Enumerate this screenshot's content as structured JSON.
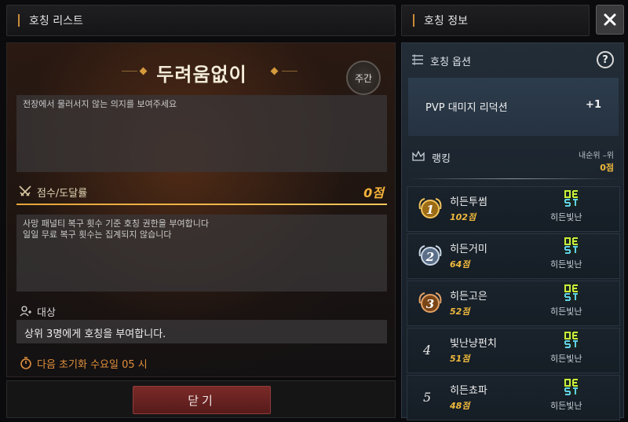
{
  "left_panel": {
    "header_title": "호칭 리스트",
    "title_name": "두려움없이",
    "period_badge": "주간",
    "description": "전장에서 물러서지 않는 의지를 보여주세요",
    "score_label": "점수/도달률",
    "score_value": "0점",
    "condition_line1": "사망 패널티 복구 횟수 기준 호칭 권한을 부여합니다",
    "condition_line2": "일일 무료 복구 횟수는 집계되지 않습니다",
    "target_label": "대상",
    "target_text": "상위 3명에게 호칭을 부여합니다.",
    "reset_text": "다음 초기화 수요일 05 시",
    "close_button": "닫기"
  },
  "right_panel": {
    "header_title": "호칭 정보",
    "options_label": "호칭 옵션",
    "option_name": "PVP 대미지 리덕션",
    "option_value": "+1",
    "ranking_label": "랭킹",
    "my_rank": "내순위 –위",
    "my_score": "0점",
    "rows": [
      {
        "rank": "1",
        "name": "히든투썸",
        "score": "102점",
        "title": "히든빛난",
        "medal": "gold"
      },
      {
        "rank": "2",
        "name": "히든거미",
        "score": "64점",
        "title": "히든빛난",
        "medal": "silver"
      },
      {
        "rank": "3",
        "name": "히든고은",
        "score": "52점",
        "title": "히든빛난",
        "medal": "bronze"
      },
      {
        "rank": "4",
        "name": "빛난냥펀치",
        "score": "51점",
        "title": "히든빛난",
        "medal": ""
      },
      {
        "rank": "5",
        "name": "히든쵸파",
        "score": "48점",
        "title": "히든빛난",
        "medal": ""
      }
    ]
  },
  "colors": {
    "accent_gold": "#f0b93d",
    "close_red": "#7a2a28",
    "reset_orange": "#e0903c"
  },
  "icons": [
    "close-icon",
    "help-icon",
    "crossed-swords-icon",
    "users-icon",
    "stopwatch-icon",
    "list-icon",
    "crown-icon",
    "best-icon"
  ]
}
